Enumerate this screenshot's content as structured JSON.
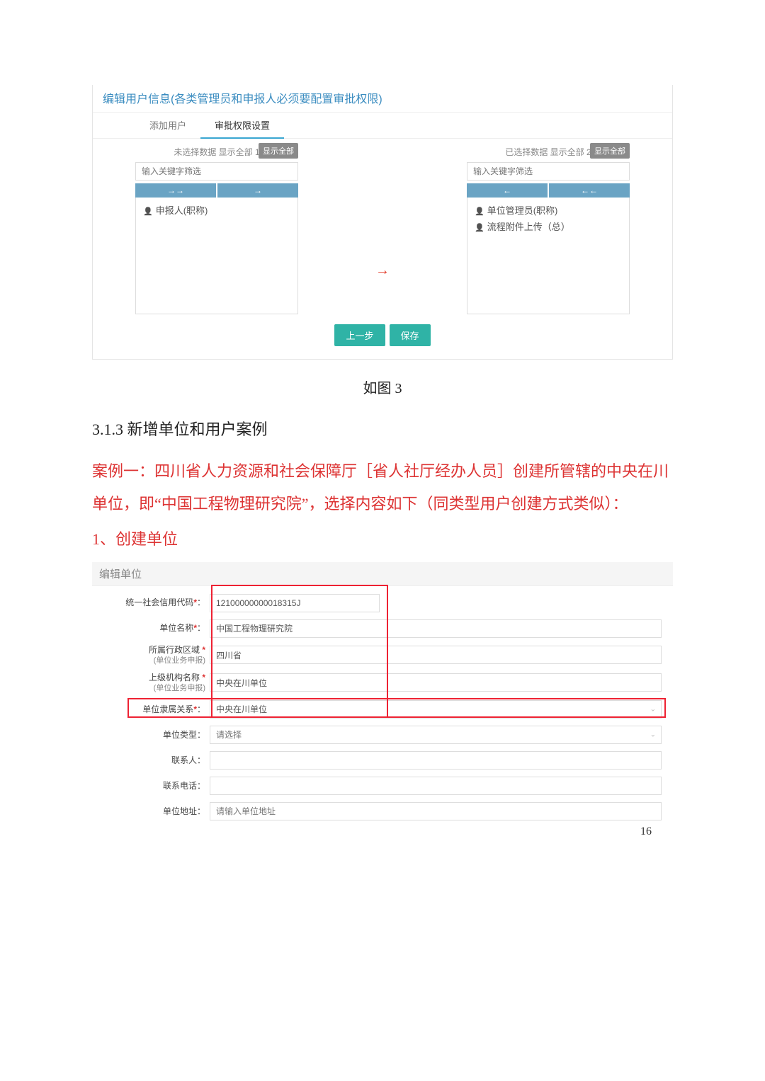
{
  "panel1": {
    "title": "编辑用户信息(各类管理员和申报人必须要配置审批权限)",
    "tabs": [
      "添加用户",
      "审批权限设置"
    ],
    "active_tab": 1,
    "left": {
      "header": "未选择数据 显示全部 1",
      "show_all": "显示全部",
      "filter_placeholder": "输入关键字筛选",
      "arrows": [
        "→→",
        "→"
      ],
      "items": [
        "申报人(职称)"
      ]
    },
    "right": {
      "header": "已选择数据 显示全部 2",
      "show_all": "显示全部",
      "filter_placeholder": "输入关键字筛选",
      "arrows": [
        "←",
        "←←"
      ],
      "items": [
        "单位管理员(职称)",
        "流程附件上传（总）"
      ]
    },
    "mid_arrow": "→",
    "buttons": {
      "prev": "上一步",
      "save": "保存"
    }
  },
  "caption": "如图 3",
  "section_heading": "3.1.3 新增单位和用户案例",
  "para1": "案例一：四川省人力资源和社会保障厅［省人社厅经办人员］创建所管辖的中央在川单位，即“中国工程物理研究院”，选择内容如下（同类型用户创建方式类似）：",
  "para2": "1、创建单位",
  "panel2": {
    "title": "编辑单位",
    "fields": {
      "code": {
        "label": "统一社会信用代码",
        "value": "12100000000018315J"
      },
      "name": {
        "label": "单位名称",
        "value": "中国工程物理研究院"
      },
      "region": {
        "label": "所属行政区域",
        "sub": "(单位业务申报)",
        "value": "四川省"
      },
      "parent_org": {
        "label": "上级机构名称",
        "sub": "(单位业务申报)",
        "value": "中央在川单位"
      },
      "affiliation": {
        "label": "单位隶属关系",
        "value": "中央在川单位"
      },
      "type": {
        "label": "单位类型",
        "placeholder": "请选择"
      },
      "contact": {
        "label": "联系人",
        "value": ""
      },
      "phone": {
        "label": "联系电话",
        "value": ""
      },
      "address": {
        "label": "单位地址",
        "placeholder": "请输入单位地址"
      }
    },
    "colon": "："
  },
  "page_number": "16"
}
